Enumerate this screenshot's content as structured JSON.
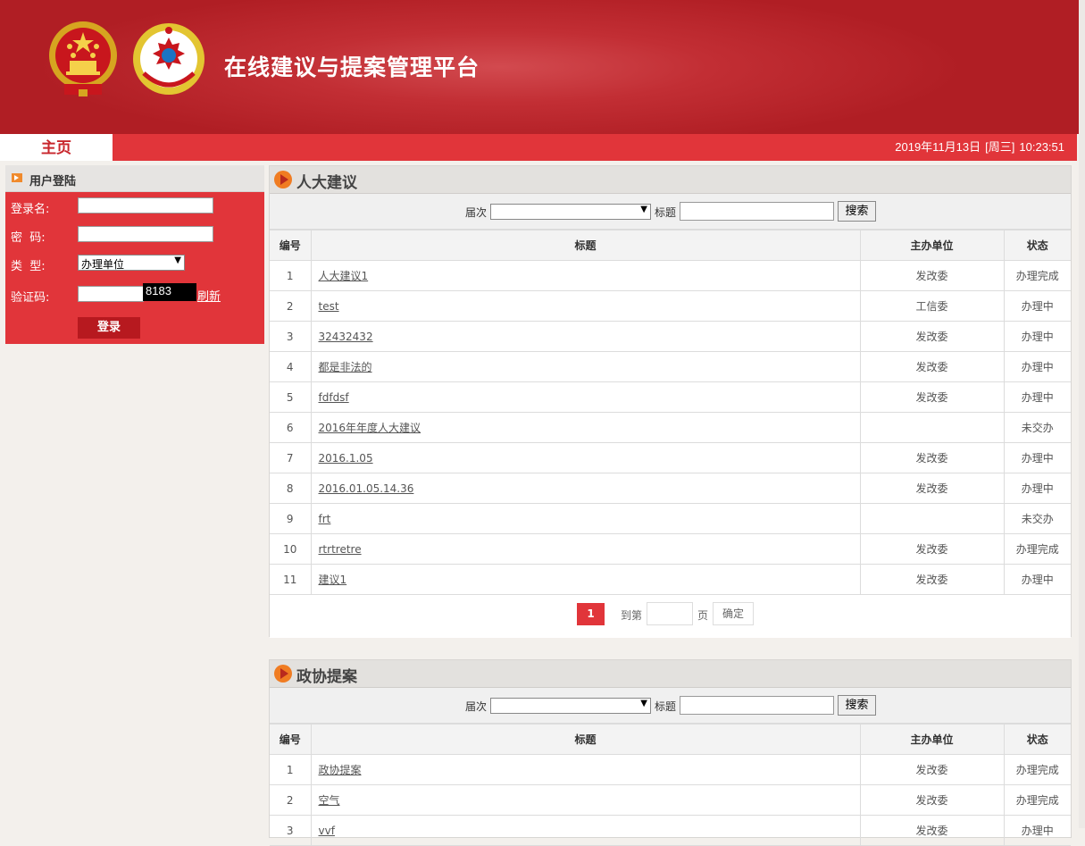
{
  "header": {
    "title": "在线建议与提案管理平台"
  },
  "nav": {
    "home": "主页",
    "date": "2019年11月13日",
    "weekday": "[周三]",
    "time": "10:23:51"
  },
  "login": {
    "heading": "用户登陆",
    "username_label": "登录名:",
    "password_label": "密  码:",
    "type_label": "类  型:",
    "type_value": "办理单位",
    "captcha_label": "验证码:",
    "captcha_code": "8183",
    "refresh": "刷新",
    "submit": "登录"
  },
  "common": {
    "session_label": "届次",
    "title_label": "标题",
    "search_btn": "搜索",
    "col_no": "编号",
    "col_title": "标题",
    "col_unit": "主办单位",
    "col_status": "状态"
  },
  "npc": {
    "title": "人大建议",
    "rows": [
      {
        "no": "1",
        "title": "人大建议1",
        "unit": "发改委",
        "status": "办理完成"
      },
      {
        "no": "2",
        "title": "test",
        "unit": "工信委",
        "status": "办理中"
      },
      {
        "no": "3",
        "title": "32432432",
        "unit": "发改委",
        "status": "办理中"
      },
      {
        "no": "4",
        "title": "都是非法的",
        "unit": "发改委",
        "status": "办理中"
      },
      {
        "no": "5",
        "title": "fdfdsf",
        "unit": "发改委",
        "status": "办理中"
      },
      {
        "no": "6",
        "title": "2016年年度人大建议",
        "unit": "",
        "status": "未交办"
      },
      {
        "no": "7",
        "title": "2016.1.05",
        "unit": "发改委",
        "status": "办理中"
      },
      {
        "no": "8",
        "title": "2016.01.05.14.36",
        "unit": "发改委",
        "status": "办理中"
      },
      {
        "no": "9",
        "title": "frt",
        "unit": "",
        "status": "未交办"
      },
      {
        "no": "10",
        "title": "rtrtretre",
        "unit": "发改委",
        "status": "办理完成"
      },
      {
        "no": "11",
        "title": "建议1",
        "unit": "发改委",
        "status": "办理中"
      }
    ],
    "pager": {
      "current": "1",
      "goto": "到第",
      "page": "页",
      "confirm": "确定"
    }
  },
  "cppcc": {
    "title": "政协提案",
    "rows": [
      {
        "no": "1",
        "title": "政协提案",
        "unit": "发改委",
        "status": "办理完成"
      },
      {
        "no": "2",
        "title": "空气",
        "unit": "发改委",
        "status": "办理完成"
      },
      {
        "no": "3",
        "title": "vvf",
        "unit": "发改委",
        "status": "办理中"
      }
    ]
  },
  "colors": {
    "header_red": "#b01e24",
    "nav_red": "#e1353a",
    "panel_red": "#e1353a"
  },
  "icons": [
    "state-emblem-icon",
    "cppcc-emblem-icon",
    "arrow-right-icon",
    "play-circle-icon",
    "dropdown-arrow-icon"
  ]
}
